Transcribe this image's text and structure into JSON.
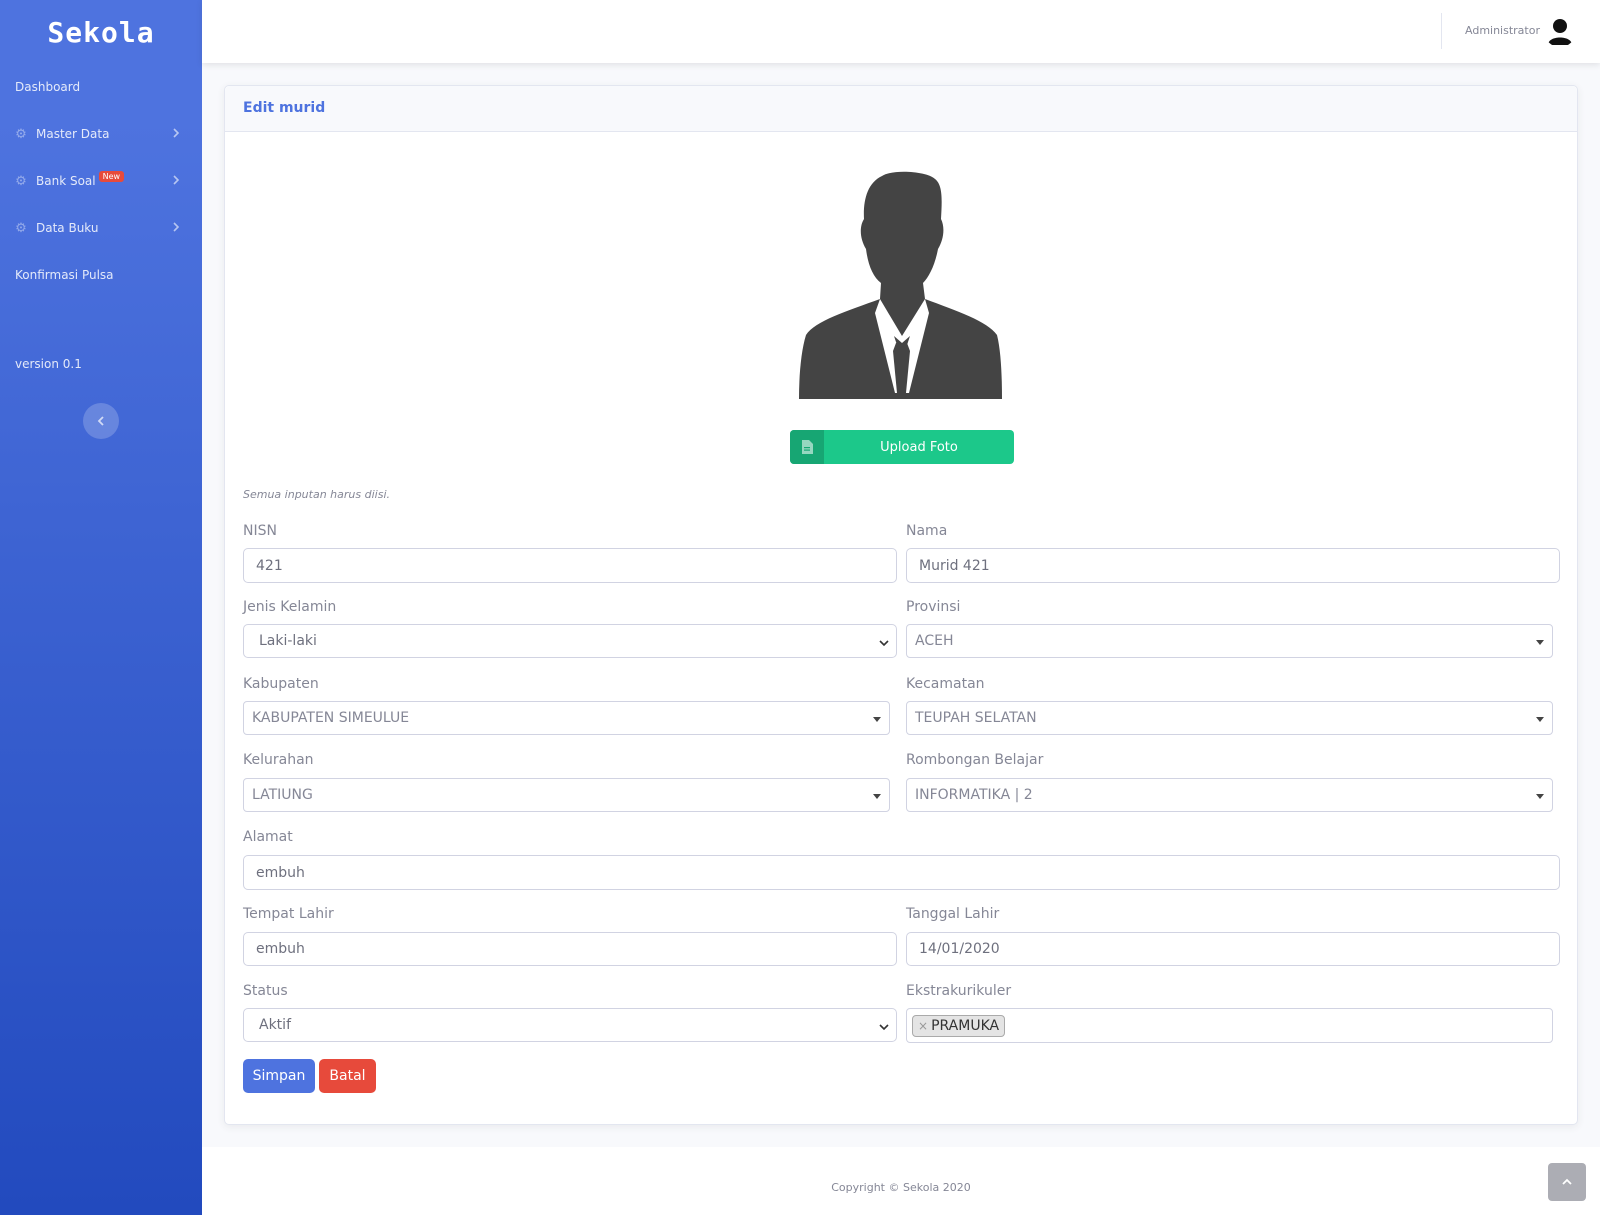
{
  "brand": "Sekola",
  "sidebar": {
    "items": [
      {
        "label": "Dashboard"
      },
      {
        "label": "Master Data"
      },
      {
        "label": "Bank Soal",
        "badge": "New"
      },
      {
        "label": "Data Buku"
      },
      {
        "label": "Konfirmasi Pulsa"
      }
    ],
    "version": "version 0.1"
  },
  "topbar": {
    "user": "Administrator"
  },
  "card": {
    "title": "Edit murid",
    "upload_label": "Upload Foto",
    "hint": "Semua inputan harus diisi."
  },
  "form": {
    "nisn": {
      "label": "NISN",
      "value": "421"
    },
    "nama": {
      "label": "Nama",
      "value": "Murid 421"
    },
    "jenis_kelamin": {
      "label": "Jenis Kelamin",
      "value": "Laki-laki"
    },
    "provinsi": {
      "label": "Provinsi",
      "value": "ACEH"
    },
    "kabupaten": {
      "label": "Kabupaten",
      "value": "KABUPATEN SIMEULUE"
    },
    "kecamatan": {
      "label": "Kecamatan",
      "value": "TEUPAH SELATAN"
    },
    "kelurahan": {
      "label": "Kelurahan",
      "value": "LATIUNG"
    },
    "rombel": {
      "label": "Rombongan Belajar",
      "value": "INFORMATIKA | 2"
    },
    "alamat": {
      "label": "Alamat",
      "value": "embuh"
    },
    "tempat_lahir": {
      "label": "Tempat Lahir",
      "value": "embuh"
    },
    "tanggal_lahir": {
      "label": "Tanggal Lahir",
      "value": "14/01/2020"
    },
    "status": {
      "label": "Status",
      "value": "Aktif"
    },
    "ekskul": {
      "label": "Ekstrakurikuler",
      "tags": [
        "PRAMUKA"
      ]
    }
  },
  "buttons": {
    "save": "Simpan",
    "cancel": "Batal"
  },
  "footer": {
    "copyright": "Copyright © Sekola 2020"
  },
  "colors": {
    "primary": "#4e73df",
    "success": "#1cc88a",
    "danger": "#e74a3b"
  }
}
